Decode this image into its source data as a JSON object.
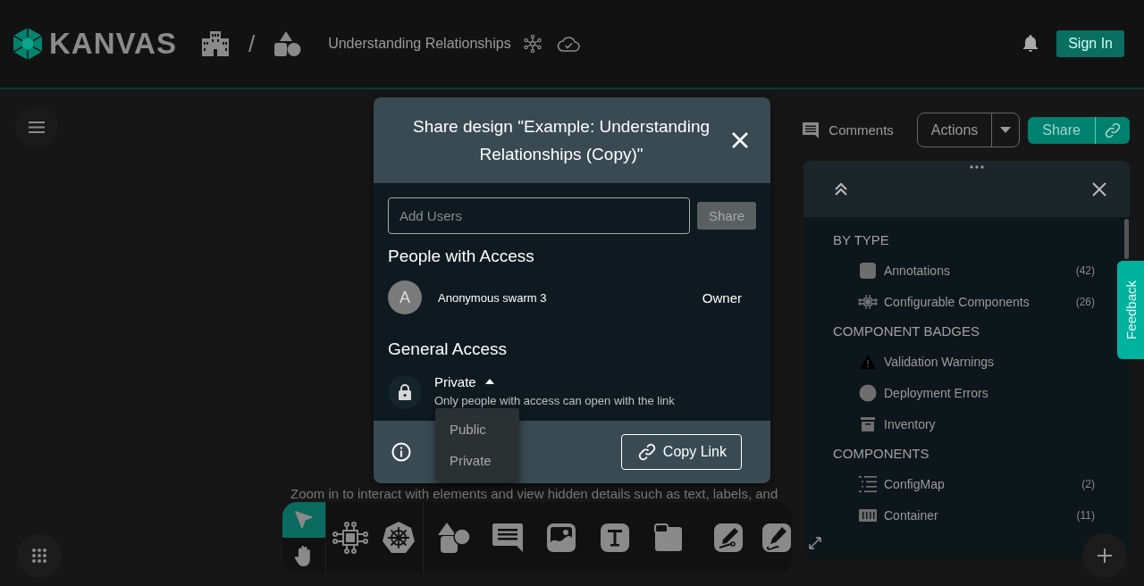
{
  "header": {
    "logo": "KANVAS",
    "separator": "/",
    "design_name": "Understanding Relationships",
    "sign_in": "Sign In"
  },
  "canvas_bar": {
    "comments": "Comments",
    "actions": "Actions",
    "share": "Share"
  },
  "hint": "Zoom in to interact with elements and view hidden details such as text, labels, and",
  "modal": {
    "title": "Share design \"Example: Understanding Relationships (Copy)\"",
    "add_users_placeholder": "Add Users",
    "share_button": {
      "label": "Share",
      "disabled": true
    },
    "people_heading": "People with Access",
    "people": [
      {
        "initial": "A",
        "name": "Anonymous swarm 3",
        "role": "Owner"
      }
    ],
    "general_heading": "General Access",
    "access": {
      "value": "Private",
      "description": "Only people with access can open with the link",
      "expanded": true,
      "options": [
        {
          "label": "Public"
        },
        {
          "label": "Private"
        }
      ]
    },
    "copy_link": "Copy Link"
  },
  "panel": {
    "sections": [
      {
        "title": "BY TYPE",
        "items": [
          {
            "kind": "square",
            "label": "Annotations",
            "count": "(42)"
          },
          {
            "kind": "component",
            "label": "Configurable Components",
            "count": "(26)"
          }
        ]
      },
      {
        "title": "COMPONENT BADGES",
        "items": [
          {
            "kind": "warning",
            "label": "Validation Warnings"
          },
          {
            "kind": "circle",
            "label": "Deployment Errors"
          },
          {
            "kind": "inventory",
            "label": "Inventory"
          }
        ]
      },
      {
        "title": "COMPONENTS",
        "items": [
          {
            "kind": "list",
            "label": "ConfigMap",
            "count": "(2)"
          },
          {
            "kind": "container",
            "label": "Container",
            "count": "(11)"
          }
        ]
      }
    ]
  },
  "feedback": "Feedback",
  "tool_groups": [
    {
      "tools": [
        {
          "kind": "pointer",
          "selected": true
        },
        {
          "kind": "hand",
          "selected": false
        }
      ]
    },
    {
      "tools": [
        {
          "kind": "component",
          "selected": false
        },
        {
          "kind": "kubernetes",
          "selected": false
        }
      ]
    },
    {
      "tools": [
        {
          "kind": "shapes",
          "selected": false
        },
        {
          "kind": "comment",
          "selected": false
        },
        {
          "kind": "image",
          "selected": false
        },
        {
          "kind": "text",
          "selected": false
        },
        {
          "kind": "section",
          "selected": false
        }
      ]
    },
    {
      "tools": [
        {
          "kind": "pen",
          "selected": false
        },
        {
          "kind": "freehand",
          "selected": false
        }
      ]
    }
  ]
}
